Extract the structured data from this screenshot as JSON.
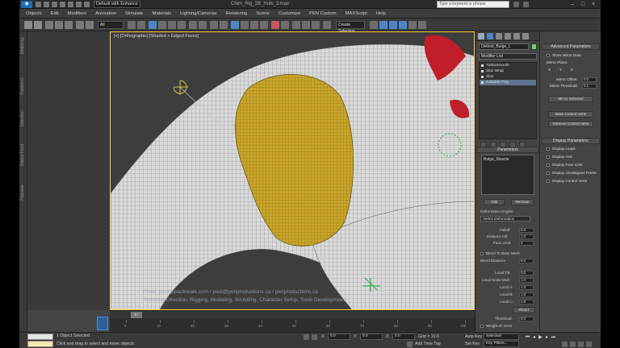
{
  "titlebar": {
    "app_icon": "3ds-max-logo",
    "workspace": "Default with Enhance",
    "title": "Chim_Rig_2B_Hulk_3.max",
    "search_placeholder": "Type a keyword or phrase"
  },
  "menu": [
    "Objects",
    "Edit",
    "Modifiers",
    "Animation",
    "Simulate",
    "Materials",
    "Lighting/Cameras",
    "Rendering",
    "Scene",
    "Customize",
    "PEN Custom",
    "MAXScript",
    "Help"
  ],
  "toolbar": {
    "selection_filter": "All",
    "ref_coord": "View",
    "named_selection": "Create Selection"
  },
  "left_tabs": [
    "Modeling",
    "Freeform",
    "Selection",
    "Object Paint",
    "Populate"
  ],
  "viewport": {
    "label": "[+] [Orthographic] [Shaded + Edged Faces]",
    "watermark_line1": "Email: paul@paulneale.com / paul@penproductions.ca / penproductions.ca",
    "watermark_line2": "Technical Direction, Rigging, Modeling, Sculpting, Character Setup, Tools Development"
  },
  "command_panel": {
    "object_name": "Deltoid_Bulge_L",
    "object_color": "#6fd46f",
    "modifier_list": "Modifier List",
    "stack": [
      {
        "label": "TurboSmooth",
        "selected": false
      },
      {
        "label": "Skin Wrap",
        "selected": false
      },
      {
        "label": "Skin",
        "selected": false
      },
      {
        "label": "Editable Poly",
        "selected": true
      }
    ],
    "parameters_head": "Parameters",
    "param_item": "Bulge_Muscle",
    "add_btn": "Add",
    "remove_btn": "Remove",
    "deform_engine_label": "Deformation Engine",
    "deform_engine": "Vertex Deformation",
    "falloff_label": "Falloff:",
    "falloff": "0.0",
    "distance_infl_label": "Distance Infl:",
    "distance_infl": "1.0",
    "face_limit_label": "Face Limit:",
    "face_limit": "3",
    "blend_label": "Blend To Base Mesh",
    "blend_distance_label": "Blend Distance",
    "blend_distance": "5.0",
    "local_labels": [
      {
        "label": "Local Tilt:",
        "value": "0.0"
      },
      {
        "label": "Local Scale Mult:",
        "value": "1.0"
      },
      {
        "label": "Local A:",
        "value": "1.0"
      },
      {
        "label": "Local B:",
        "value": "1.0"
      },
      {
        "label": "Local C:",
        "value": "1.0"
      }
    ],
    "reset_btn": "Reset",
    "threshold_label": "Threshold:",
    "threshold": "0.0",
    "weight_all_label": "Weight All Verts"
  },
  "advanced": {
    "head": "Advanced Parameters",
    "show_mirror": "Show Mirror Data",
    "mirror_plane": "Mirror Plane:",
    "mirror_axes": [
      "X",
      "Y",
      "Z"
    ],
    "mirror_offset_label": "Mirror Offset:",
    "mirror_offset": "0.0",
    "mirror_threshold_label": "Mirror Threshold:",
    "mirror_threshold": "0.1",
    "mirror_selected_btn": "Mirror Selected",
    "bake_btn": "Bake Control Verts",
    "retrieve_btn": "Retrieve Control Verts",
    "display_head": "Display Parameters",
    "display_items": [
      "Display Loops",
      "Display Axis",
      "Display Face Limit",
      "Display Unassigned Points",
      "Display Control Verts"
    ]
  },
  "timeline": {
    "slider": "0 / 100",
    "ticks": [
      "0",
      "10",
      "20",
      "30",
      "40",
      "50",
      "60",
      "70",
      "80",
      "90",
      "100"
    ]
  },
  "statusbar": {
    "selected": "1 Object Selected",
    "prompt": "Click and drag to select and move objects",
    "x_label": "X:",
    "x_val": "0.0",
    "y_label": "Y:",
    "y_val": "0.0",
    "z_label": "Z:",
    "z_val": "0.0",
    "grid": "Grid = 10.0",
    "add_time_tag": "Add Time Tag",
    "auto_key": "Auto Key",
    "selected_dd": "Selected",
    "set_key": "Set Key",
    "key_filters": "Key Filters..."
  }
}
